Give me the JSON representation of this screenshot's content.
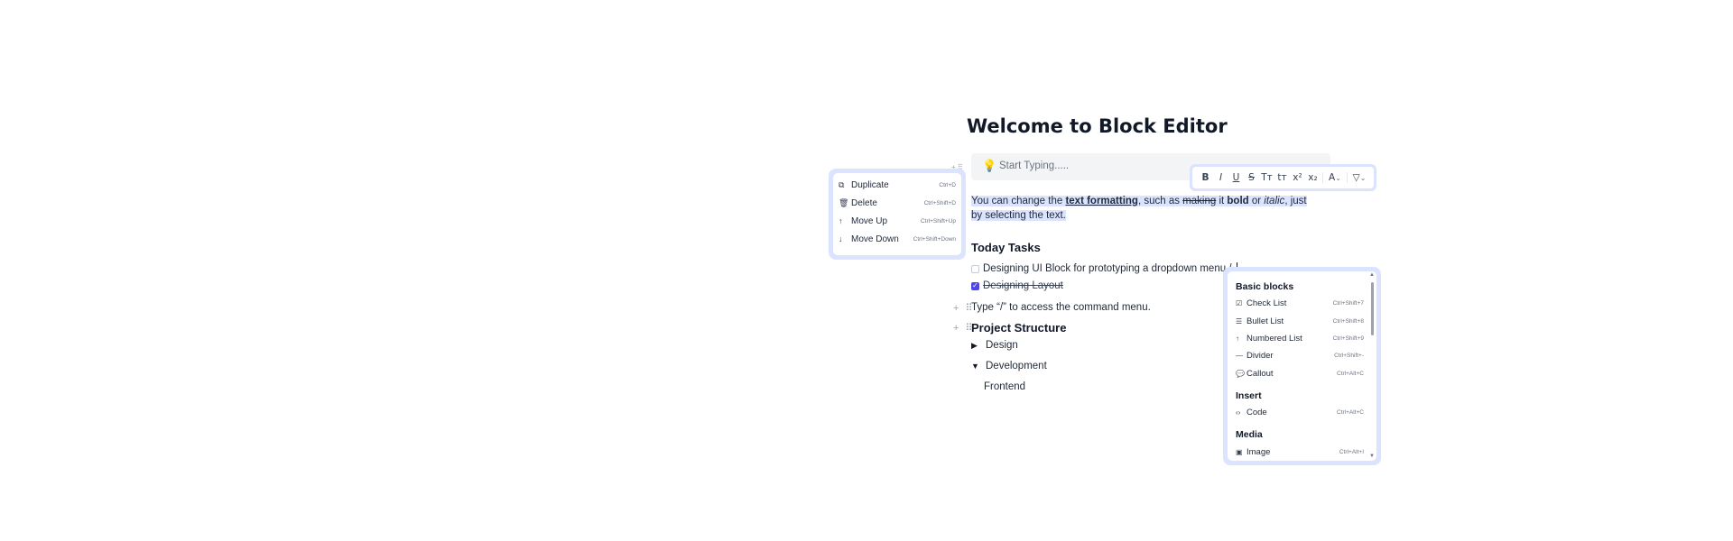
{
  "editor": {
    "title": "Welcome to Block Editor",
    "callout": {
      "icon": "lightbulb-icon",
      "placeholder": "Start Typing....."
    },
    "paragraph": {
      "t1": "You can change the ",
      "bold_underline": "text formatting",
      "t2": ", such as ",
      "strike": "making",
      "t3": " it ",
      "bold": "bold",
      "t4": " or ",
      "italic": "italic",
      "t5": ", just by selecting the text."
    },
    "tasks_heading": "Today Tasks",
    "tasks": [
      {
        "label": "Designing UI Block for prototyping a dropdown menu /",
        "checked": false
      },
      {
        "label": "Designing Layout",
        "checked": true
      }
    ],
    "hint": "Type “/” to access the command menu.",
    "project_heading": "Project Structure",
    "toggles": [
      {
        "label": "Design",
        "expanded": false
      },
      {
        "label": "Development",
        "expanded": true
      }
    ],
    "nested": "Frontend",
    "handles": {
      "plus": "+",
      "drag": "⠿"
    }
  },
  "format_toolbar": {
    "buttons": [
      "B",
      "I",
      "U",
      "S",
      "Tт",
      "tт",
      "x²",
      "x₂",
      "A",
      "▽"
    ],
    "chevron": "⌄"
  },
  "block_menu": {
    "items": [
      {
        "icon": "copy-icon",
        "label": "Duplicate",
        "shortcut": "Ctrl+D"
      },
      {
        "icon": "trash-icon",
        "label": "Delete",
        "shortcut": "Ctrl+Shift+D"
      },
      {
        "icon": "arrow-up-icon",
        "label": "Move Up",
        "shortcut": "Ctrl+Shift+Up"
      },
      {
        "icon": "arrow-down-icon",
        "label": "Move Down",
        "shortcut": "Ctrl+Shift+Down"
      }
    ]
  },
  "command_menu": {
    "groups": [
      {
        "name": "Basic blocks",
        "items": [
          {
            "icon": "check-square-icon",
            "label": "Check List",
            "shortcut": "Ctrl+Shift+7"
          },
          {
            "icon": "list-icon",
            "label": "Bullet List",
            "shortcut": "Ctrl+Shift+8"
          },
          {
            "icon": "ordered-list-icon",
            "label": "Numbered List",
            "shortcut": "Ctrl+Shift+9"
          },
          {
            "icon": "minus-icon",
            "label": "Divider",
            "shortcut": "Ctrl+Shift+-"
          },
          {
            "icon": "message-icon",
            "label": "Callout",
            "shortcut": "Ctrl+Alt+C"
          }
        ]
      },
      {
        "name": "Insert",
        "items": [
          {
            "icon": "code-icon",
            "label": "Code",
            "shortcut": "Ctrl+Alt+C"
          }
        ]
      },
      {
        "name": "Media",
        "items": [
          {
            "icon": "image-icon",
            "label": "Image",
            "shortcut": "Ctrl+Alt+I"
          }
        ]
      }
    ]
  },
  "colors": {
    "accent": "#4f46e5",
    "selection": "#dbe3ff",
    "callout_bg": "#f3f4f6"
  }
}
